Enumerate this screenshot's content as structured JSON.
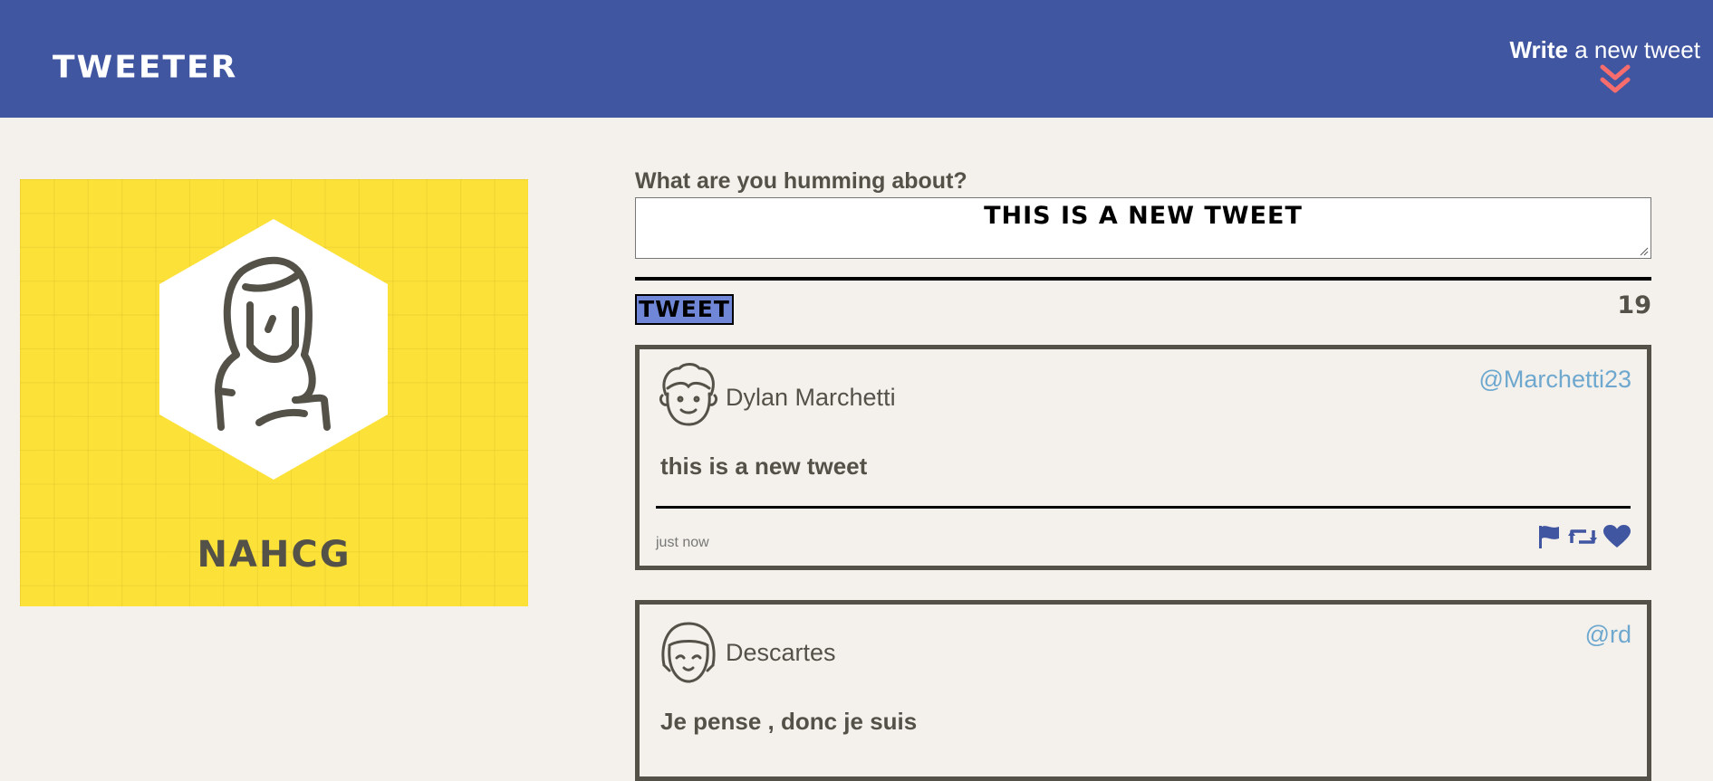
{
  "nav": {
    "brand": "TWEETER",
    "write_bold": "Write",
    "write_rest": " a new tweet"
  },
  "profile": {
    "name": "NAHCG"
  },
  "compose": {
    "label": "What are you humming about?",
    "value": "THIS IS A NEW TWEET",
    "button": "TWEET",
    "counter": "19"
  },
  "tweets": [
    {
      "name": "Dylan Marchetti",
      "handle": "@Marchetti23",
      "text": "this is a new tweet",
      "time": "just now",
      "icons": [
        "flag-icon",
        "retweet-icon",
        "heart-icon"
      ]
    },
    {
      "name": "Descartes",
      "handle": "@rd",
      "text": "Je pense , donc je suis"
    }
  ],
  "colors": {
    "nav": "#4056a1",
    "accent": "#f76c6c",
    "profile_bg": "#fce138",
    "text": "#545149",
    "button": "#7086d6",
    "handle": "#6ea8cf",
    "page_bg": "#f4f1ec"
  }
}
